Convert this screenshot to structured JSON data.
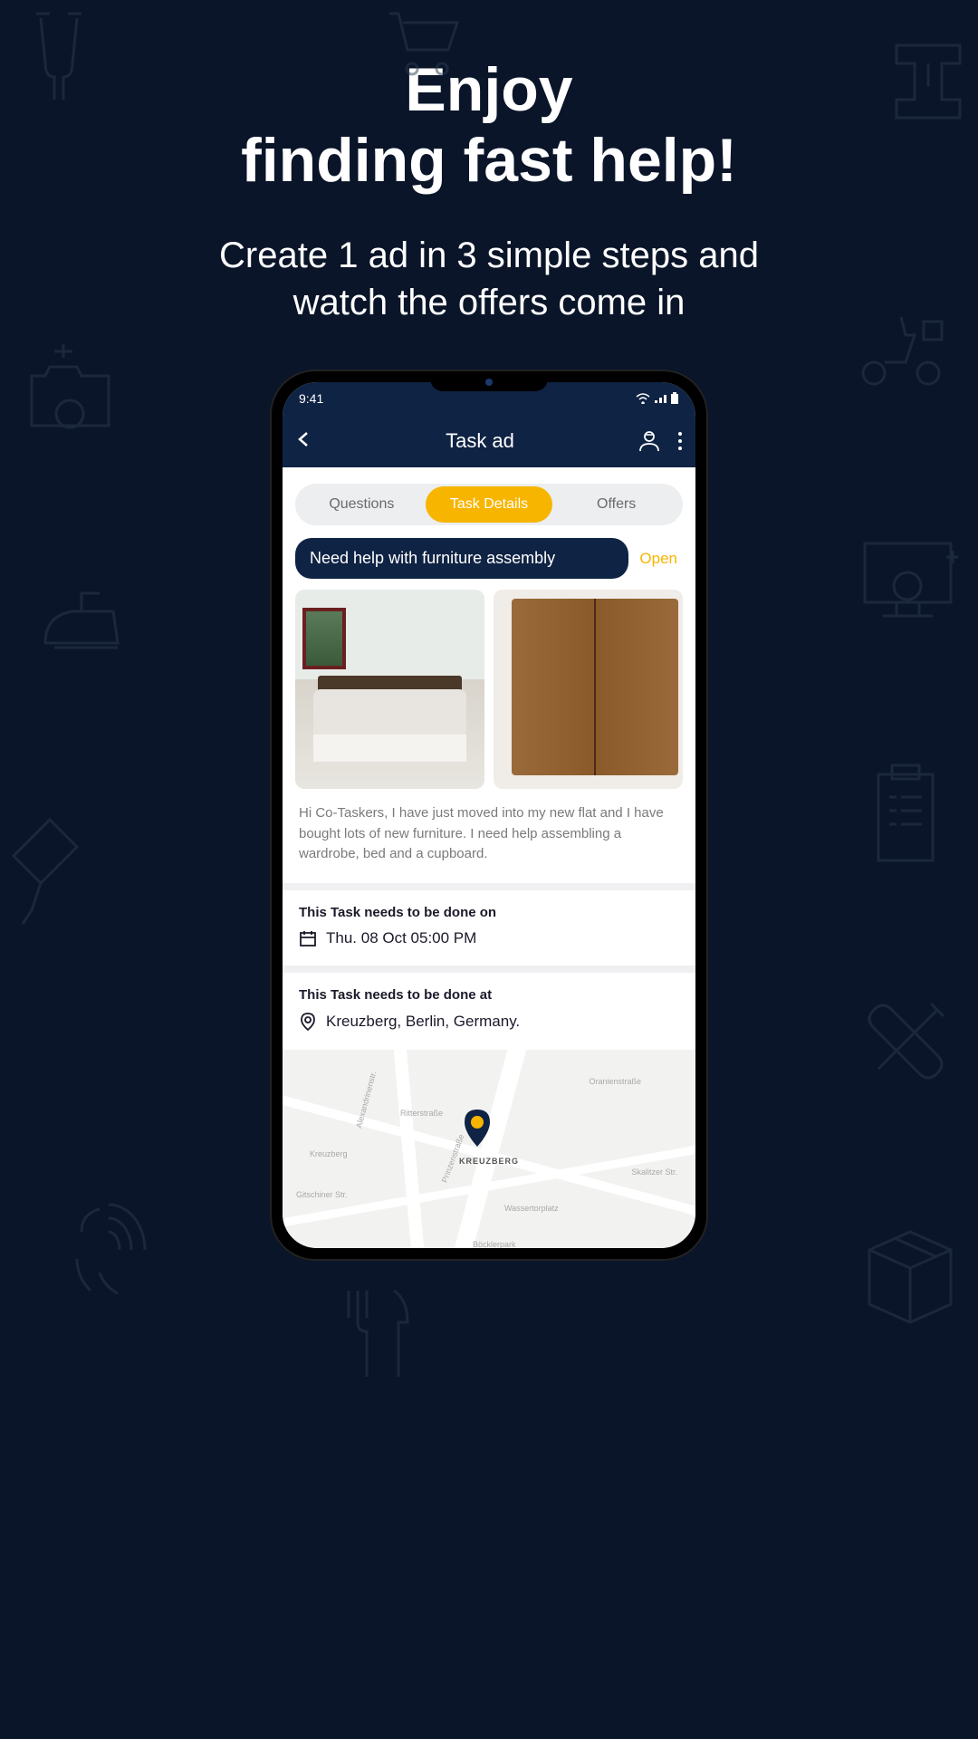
{
  "hero": {
    "title_line1": "Enjoy",
    "title_line2": "finding fast help!",
    "sub_line1": "Create 1 ad in 3 simple steps and",
    "sub_line2": "watch the offers come in"
  },
  "statusbar": {
    "time": "9:41"
  },
  "navbar": {
    "title": "Task ad"
  },
  "tabs": {
    "questions": "Questions",
    "details": "Task Details",
    "offers": "Offers"
  },
  "task": {
    "title": "Need help with furniture assembly",
    "status": "Open",
    "description": "Hi Co-Taskers, I have just moved into my new flat and I have bought lots of new furniture. I need help assembling a wardrobe, bed and a cupboard."
  },
  "when": {
    "label": "This Task needs to be done on",
    "value": "Thu. 08 Oct 05:00 PM"
  },
  "where": {
    "label": "This Task needs to be done at",
    "value": "Kreuzberg, Berlin, Germany."
  },
  "map": {
    "center_label": "KREUZBERG",
    "labels": [
      "Gitschiner Str.",
      "Skalitzer Str.",
      "Oranienstraße",
      "Wassertorplatz",
      "Böcklerpark",
      "Alexandrinenstr.",
      "Ritterstraße",
      "Prinzenstraße",
      "Kreuzberg"
    ]
  }
}
